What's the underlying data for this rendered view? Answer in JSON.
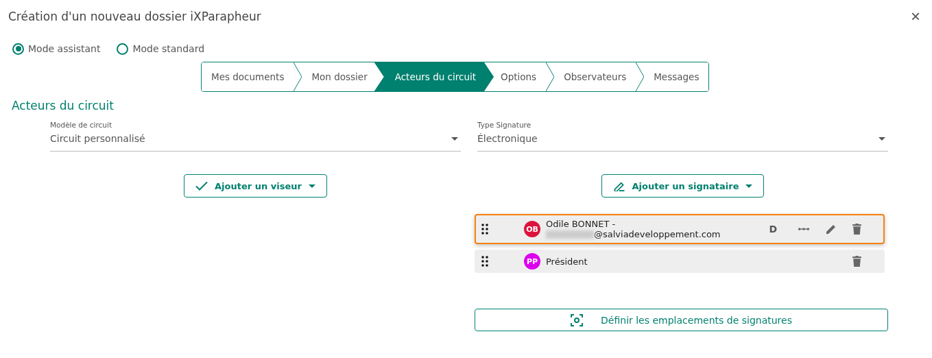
{
  "window": {
    "title": "Création d'un nouveau dossier iXParapheur",
    "close": "×"
  },
  "modes": [
    {
      "label": "Mode assistant",
      "selected": true
    },
    {
      "label": "Mode standard",
      "selected": false
    }
  ],
  "steps": [
    {
      "label": "Mes documents",
      "selected": false
    },
    {
      "label": "Mon dossier",
      "selected": false
    },
    {
      "label": "Acteurs du circuit",
      "selected": true
    },
    {
      "label": "Options",
      "selected": false
    },
    {
      "label": "Observateurs",
      "selected": false
    },
    {
      "label": "Messages",
      "selected": false
    }
  ],
  "section_title": "Acteurs du circuit",
  "fields": [
    {
      "label": "Modèle de circuit",
      "value": "Circuit personnalisé"
    },
    {
      "label": "Type Signature",
      "value": "Électronique"
    }
  ],
  "add_buttons": [
    {
      "kind": "viewer",
      "label": "Ajouter un viseur"
    },
    {
      "kind": "signer",
      "label": "Ajouter un signataire"
    }
  ],
  "signers": [
    {
      "initials": "OB",
      "color": "#dc143c",
      "name": "Odile BONNET -",
      "email": "@salviadeveloppement.com",
      "email_redacted": true,
      "badge": "D",
      "actions": [
        {
          "kind": "dots"
        },
        {
          "kind": "edit"
        },
        {
          "kind": "delete"
        }
      ],
      "selected": true
    },
    {
      "initials": "PP",
      "color": "#dd00ee",
      "name": "Président",
      "actions": [
        {
          "kind": "delete"
        }
      ],
      "selected": false
    }
  ],
  "define_button": "Définir les emplacements de signatures"
}
